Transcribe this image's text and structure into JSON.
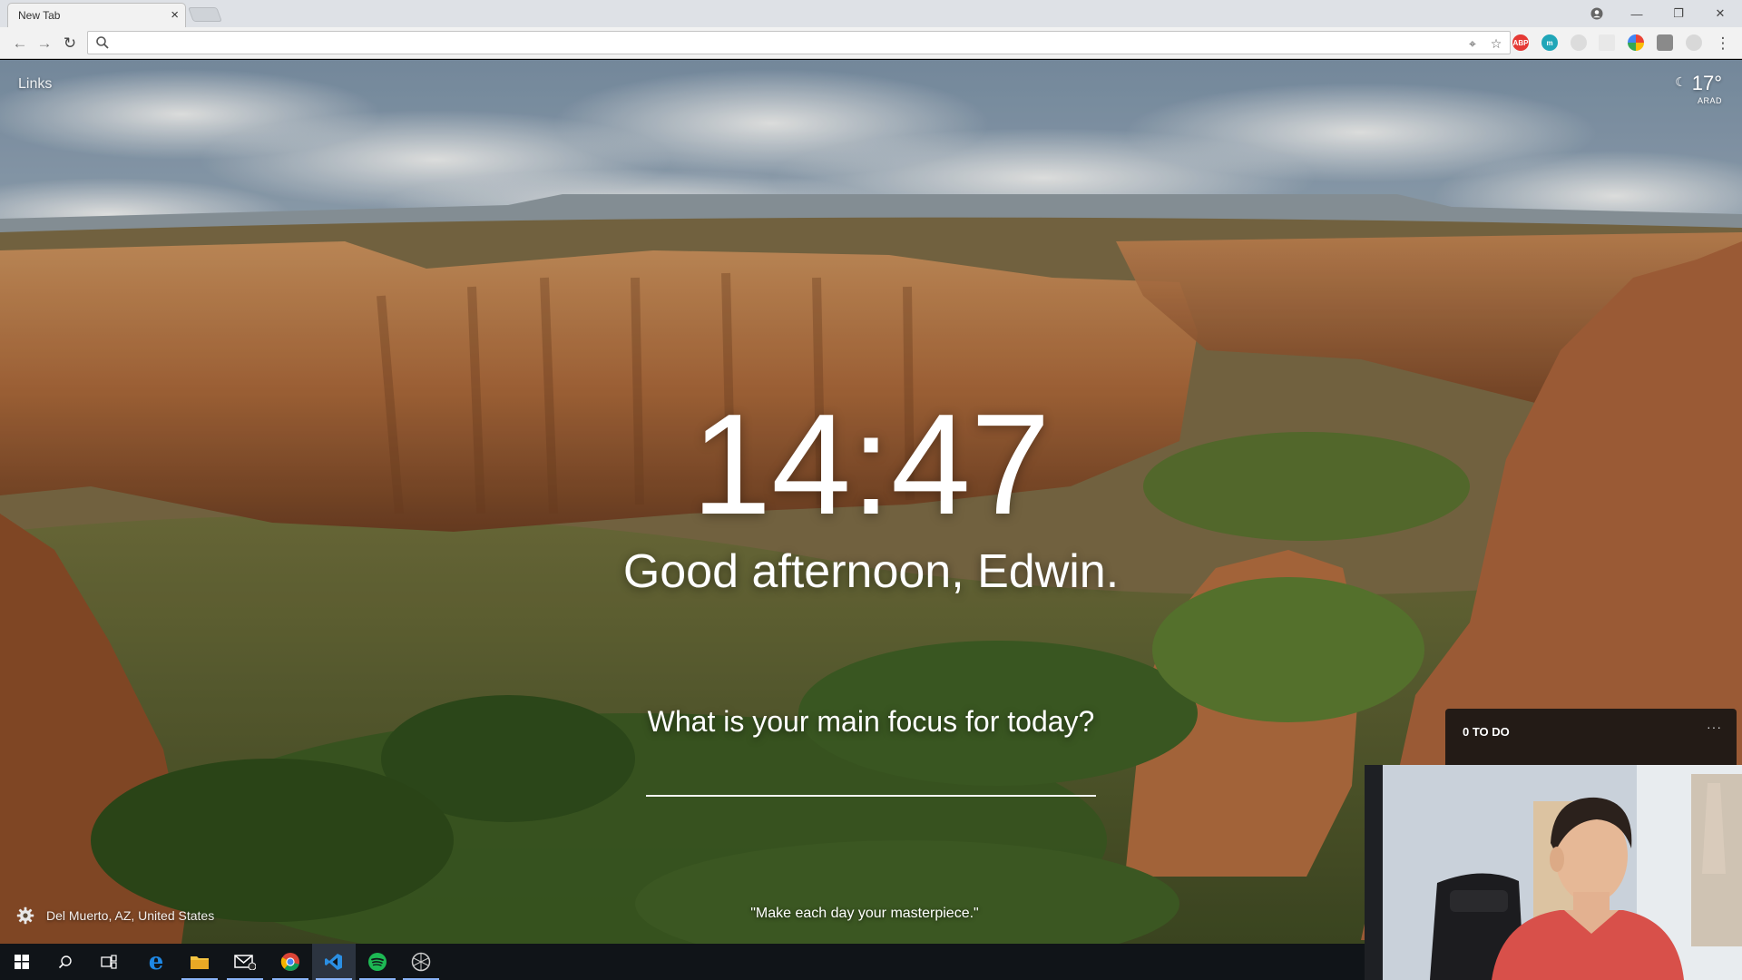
{
  "browser": {
    "tab": {
      "title": "New Tab"
    },
    "omnibox": {
      "value": ""
    }
  },
  "links": {
    "label": "Links"
  },
  "weather": {
    "temperature": "17°",
    "city": "ARAD",
    "icon": "moon-icon"
  },
  "clock": {
    "time": "14:47"
  },
  "greeting": {
    "text": "Good afternoon, Edwin."
  },
  "focus": {
    "question": "What is your main focus for today?",
    "value": ""
  },
  "location": {
    "text": "Del Muerto, AZ, United States"
  },
  "quote": {
    "text": "\"Make each day your masterpiece.\""
  },
  "todo": {
    "title": "0 TO DO",
    "more": "···"
  },
  "taskbar": {
    "items": [
      "start-icon",
      "search-icon",
      "task-view-icon",
      "edge-icon",
      "file-explorer-icon",
      "mail-icon",
      "chrome-icon",
      "vscode-icon",
      "spotify-icon",
      "app-icon"
    ]
  },
  "colors": {
    "accent": "#8ab4f8",
    "taskbar": "#101418",
    "todo_bg": "#121212"
  }
}
